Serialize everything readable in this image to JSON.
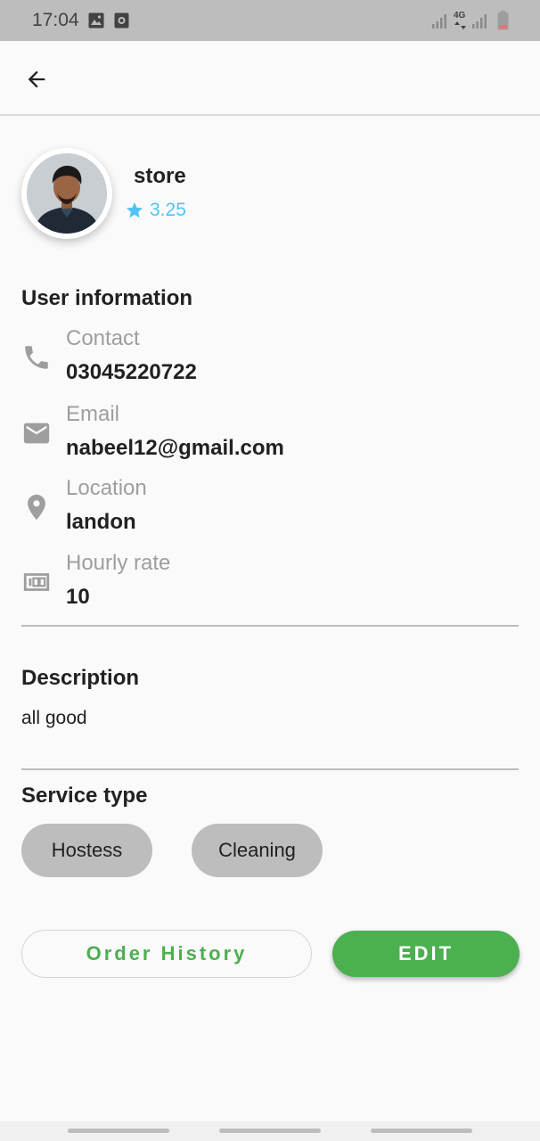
{
  "status_bar": {
    "time": "17:04",
    "network_label": "4G",
    "icons": [
      "gallery-icon",
      "screen-record-icon",
      "signal-icon",
      "network-4g-icon",
      "signal-icon",
      "battery-icon"
    ]
  },
  "app_bar": {
    "back_icon": "arrow-left-icon"
  },
  "profile": {
    "name": "store",
    "rating": "3.25",
    "rating_icon": "star-icon",
    "rating_color": "#4fc3f7"
  },
  "user_info": {
    "title": "User information",
    "items": [
      {
        "icon": "phone-icon",
        "label": "Contact",
        "value": "03045220722"
      },
      {
        "icon": "email-icon",
        "label": "Email",
        "value": "nabeel12@gmail.com"
      },
      {
        "icon": "location-pin-icon",
        "label": "Location",
        "value": "landon"
      },
      {
        "icon": "money-icon",
        "label": "Hourly rate",
        "value": "10"
      }
    ]
  },
  "description": {
    "title": "Description",
    "text": "all good"
  },
  "service_type": {
    "title": "Service type",
    "chips": [
      "Hostess",
      "Cleaning"
    ]
  },
  "actions": {
    "order_history_label": "Order History",
    "edit_label": "EDIT",
    "accent_color": "#4caf50"
  }
}
